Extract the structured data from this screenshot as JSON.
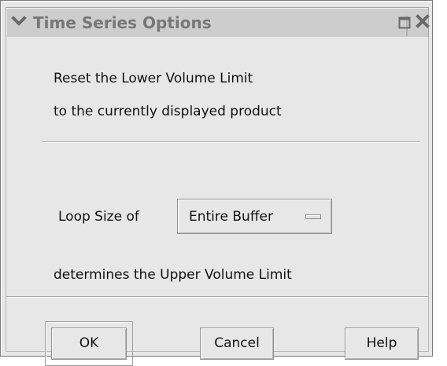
{
  "window": {
    "title": "Time Series Options"
  },
  "message": {
    "line1": "Reset the Lower Volume Limit",
    "line2": "to the currently displayed product"
  },
  "loop": {
    "label": "Loop Size of",
    "selected": "Entire Buffer",
    "after_text": "determines the Upper Volume Limit"
  },
  "buttons": {
    "ok": "OK",
    "cancel": "Cancel",
    "help": "Help"
  },
  "icons": {
    "title_menu": "chevron-down-icon",
    "maximize": "window-maximize-icon",
    "close": "close-icon",
    "dropdown": "dropdown-indicator-icon"
  },
  "colors": {
    "window_bg": "#e7e7e7",
    "titlebar_bg": "#cdcdcd",
    "title_text": "#777777",
    "border": "#8e8e8e"
  }
}
